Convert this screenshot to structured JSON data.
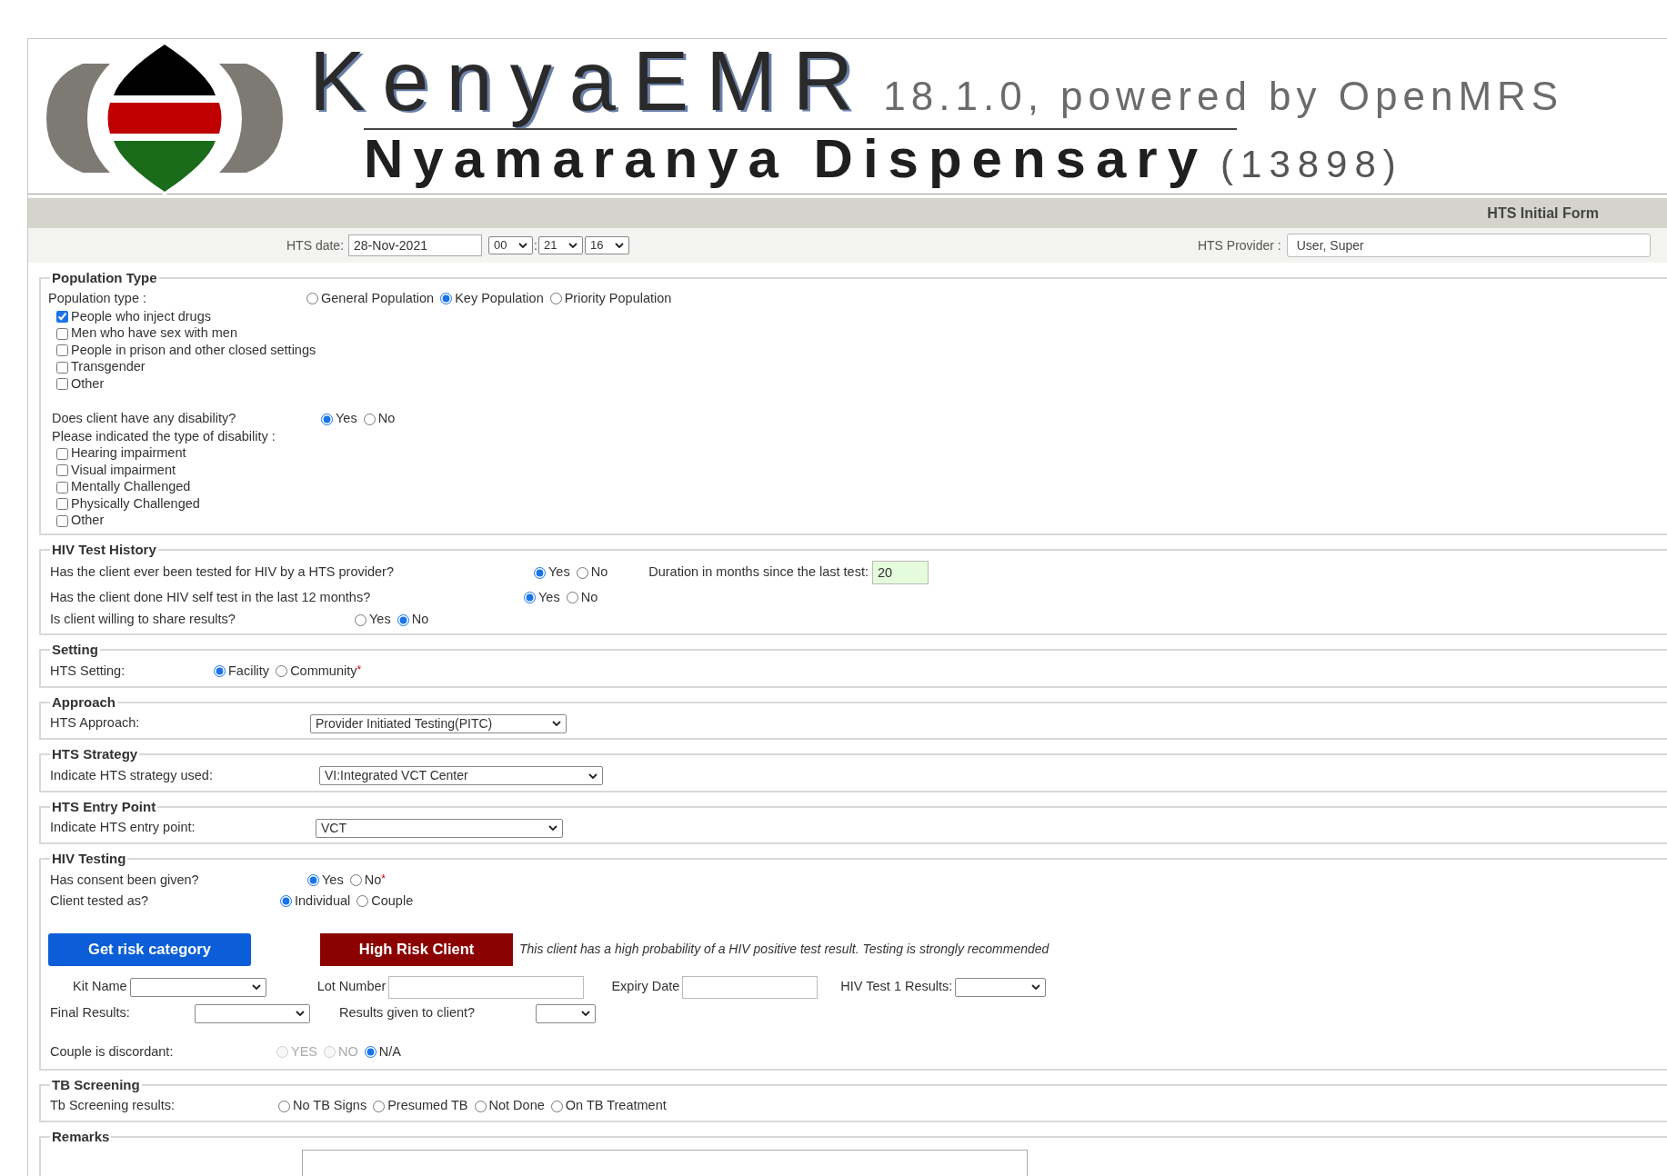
{
  "header": {
    "app_name": "KenyaEMR",
    "version": "18.1.0, powered by OpenMRS",
    "facility": "Nyamaranya Dispensary",
    "facility_code": "(13898)"
  },
  "form": {
    "title": "HTS Initial Form",
    "date_label": "HTS date:",
    "date": "28-Nov-2021",
    "hour": "00",
    "separator": ":",
    "minute": "21",
    "second": "16",
    "provider_label": "HTS Provider :",
    "provider": "User, Super"
  },
  "sections": [
    {
      "title": "Population Type",
      "rows": [
        {
          "kind": "radio",
          "label": "Population type :",
          "options": [
            {
              "label": "General Population",
              "selected": false
            },
            {
              "label": "Key Population",
              "selected": true
            },
            {
              "label": "Priority Population",
              "selected": false
            }
          ]
        },
        {
          "kind": "checks",
          "items": [
            {
              "label": "People who inject drugs",
              "checked": true
            },
            {
              "label": "Men who have sex with men",
              "checked": false
            },
            {
              "label": "People in prison and other closed settings",
              "checked": false
            },
            {
              "label": "Transgender",
              "checked": false
            },
            {
              "label": "Other",
              "checked": false
            }
          ]
        },
        {
          "kind": "radio",
          "label": "Does client have any disability?",
          "options": [
            {
              "label": "Yes",
              "selected": true
            },
            {
              "label": "No",
              "selected": false
            }
          ]
        },
        {
          "kind": "text",
          "label": "Please indicated the type of disability :"
        },
        {
          "kind": "checks",
          "items": [
            {
              "label": "Hearing impairment",
              "checked": false
            },
            {
              "label": "Visual impairment",
              "checked": false
            },
            {
              "label": "Mentally Challenged",
              "checked": false
            },
            {
              "label": "Physically Challenged",
              "checked": false
            },
            {
              "label": "Other",
              "checked": false
            }
          ]
        }
      ]
    },
    {
      "title": "HIV Test History",
      "rows": [
        {
          "kind": "radio",
          "label": "Has the client ever been tested for HIV by a HTS provider?",
          "options": [
            {
              "label": "Yes",
              "selected": true
            },
            {
              "label": "No",
              "selected": false
            }
          ],
          "extra": {
            "label": "Duration in months since the last test:",
            "value": "20"
          }
        },
        {
          "kind": "radio",
          "label": "Has the client done HIV self test in the last 12 months?",
          "options": [
            {
              "label": "Yes",
              "selected": true
            },
            {
              "label": "No",
              "selected": false
            }
          ]
        },
        {
          "kind": "radio",
          "label": "Is client willing to share results?",
          "options": [
            {
              "label": "Yes",
              "selected": false
            },
            {
              "label": "No",
              "selected": true
            }
          ]
        }
      ]
    },
    {
      "title": "Setting",
      "rows": [
        {
          "kind": "radio",
          "label": "HTS Setting:",
          "required_mark": "*",
          "options": [
            {
              "label": "Facility",
              "selected": true
            },
            {
              "label": "Community",
              "selected": false
            }
          ]
        }
      ]
    },
    {
      "title": "Approach",
      "rows": [
        {
          "kind": "select",
          "label": "HTS Approach:",
          "value": "Provider Initiated Testing(PITC)"
        }
      ]
    },
    {
      "title": "HTS Strategy",
      "rows": [
        {
          "kind": "select",
          "label": "Indicate HTS strategy used:",
          "value": "VI:Integrated VCT Center"
        }
      ]
    },
    {
      "title": "HTS Entry Point",
      "rows": [
        {
          "kind": "select",
          "label": "Indicate HTS entry point:",
          "value": "VCT"
        }
      ]
    },
    {
      "title": "HIV Testing",
      "rows": [
        {
          "kind": "radio",
          "label": "Has consent been given?",
          "required_mark": "*",
          "options": [
            {
              "label": "Yes",
              "selected": true
            },
            {
              "label": "No",
              "selected": false
            }
          ]
        },
        {
          "kind": "radio",
          "label": "Client tested as?",
          "options": [
            {
              "label": "Individual",
              "selected": true
            },
            {
              "label": "Couple",
              "selected": false
            }
          ]
        },
        {
          "kind": "risk",
          "button": "Get risk category",
          "badge": "High Risk Client",
          "message": "This client has a high probability of a HIV positive test result. Testing is strongly recommended"
        },
        {
          "kind": "fields",
          "fields": [
            {
              "label": "Kit Name",
              "kind": "select"
            },
            {
              "label": "Lot Number",
              "kind": "input"
            },
            {
              "label": "Expiry Date",
              "kind": "input"
            },
            {
              "label": "HIV Test 1 Results:",
              "kind": "select"
            }
          ]
        },
        {
          "kind": "fields",
          "fields": [
            {
              "label": "Final Results:",
              "kind": "select"
            },
            {
              "label": "Results given to client?",
              "kind": "select"
            }
          ]
        },
        {
          "kind": "radio",
          "label": "Couple is discordant:",
          "options": [
            {
              "label": "YES",
              "selected": false,
              "disabled": true
            },
            {
              "label": "NO",
              "selected": false,
              "disabled": true
            },
            {
              "label": "N/A",
              "selected": true,
              "disabled": false
            }
          ]
        }
      ]
    },
    {
      "title": "TB Screening",
      "rows": [
        {
          "kind": "radio",
          "label": "Tb Screening results:",
          "options": [
            {
              "label": "No TB Signs",
              "selected": false
            },
            {
              "label": "Presumed TB",
              "selected": false
            },
            {
              "label": "Not Done",
              "selected": false
            },
            {
              "label": "On TB Treatment",
              "selected": false
            }
          ]
        }
      ]
    },
    {
      "title": "Remarks",
      "rows": [
        {
          "kind": "textarea"
        }
      ]
    }
  ]
}
